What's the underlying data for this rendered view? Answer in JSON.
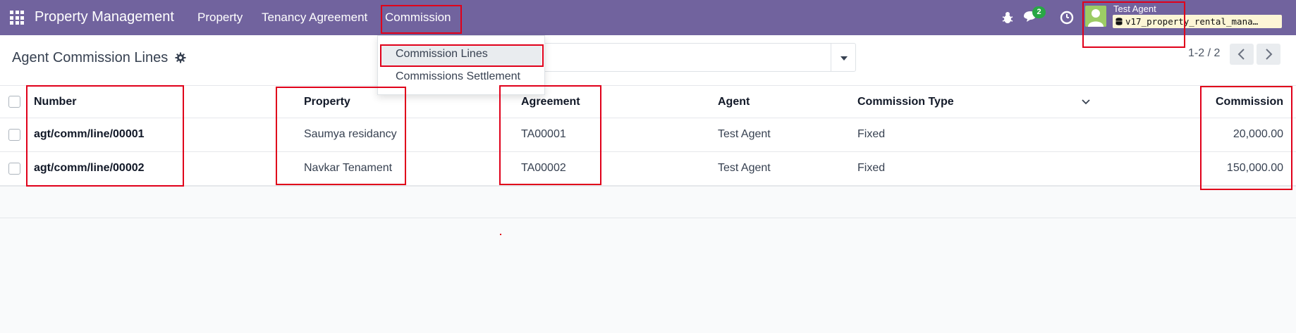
{
  "navbar": {
    "brand": "Property Management",
    "menus": [
      "Property",
      "Tenancy Agreement",
      "Commission"
    ],
    "messages_count": "2",
    "user_name": "Test Agent",
    "database": "v17_property_rental_mana…"
  },
  "commission_menu": {
    "items": [
      "Commission Lines",
      "Commissions Settlement"
    ],
    "active": "Commission Lines"
  },
  "control_panel": {
    "title": "Agent Commission Lines",
    "search_placeholder": "",
    "pager": "1-2 / 2"
  },
  "table": {
    "columns": [
      "Number",
      "Property",
      "Agreement",
      "Agent",
      "Commission Type",
      "Commission"
    ],
    "rows": [
      {
        "number": "agt/comm/line/00001",
        "property": "Saumya residancy",
        "agreement": "TA00001",
        "agent": "Test Agent",
        "commission_type": "Fixed",
        "commission": "20,000.00"
      },
      {
        "number": "agt/comm/line/00002",
        "property": "Navkar Tenament",
        "agreement": "TA00002",
        "agent": "Test Agent",
        "commission_type": "Fixed",
        "commission": "150,000.00"
      }
    ]
  },
  "colors": {
    "navbar": "#71639e",
    "highlight": "#e0001a",
    "badge": "#28a745"
  }
}
